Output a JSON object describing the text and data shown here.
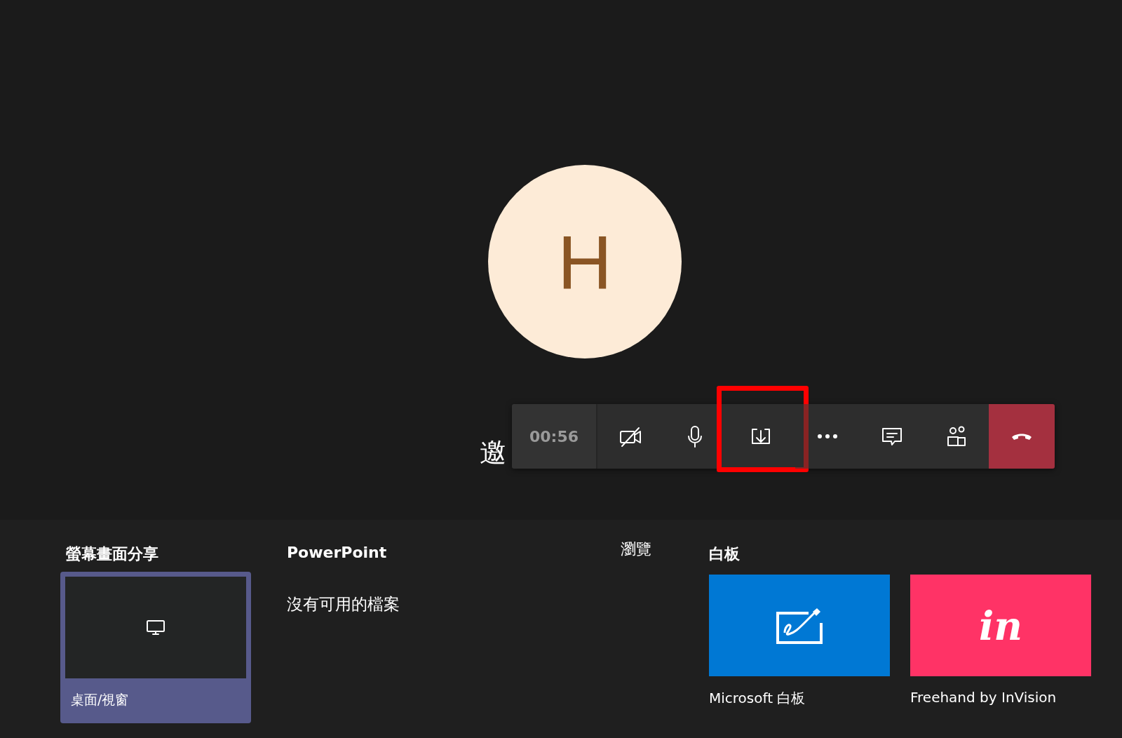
{
  "avatar": {
    "initial": "H"
  },
  "invite_text": "邀",
  "toolbar": {
    "timer": "00:56",
    "buttons": [
      {
        "kind": "camera",
        "on": false,
        "highlighted": false
      },
      {
        "kind": "mic",
        "on": true,
        "highlighted": false
      },
      {
        "kind": "share",
        "highlighted": true
      },
      {
        "kind": "more",
        "highlighted": false
      },
      {
        "kind": "chat",
        "highlighted": false
      },
      {
        "kind": "people",
        "highlighted": false
      },
      {
        "kind": "hangup",
        "highlighted": false
      }
    ]
  },
  "share_tray": {
    "screen_share": {
      "title": "螢幕畫面分享",
      "items": [
        {
          "label": "桌面/視窗",
          "selected": true
        }
      ]
    },
    "powerpoint": {
      "title": "PowerPoint",
      "browse": "瀏覽",
      "empty": "沒有可用的檔案"
    },
    "whiteboard": {
      "title": "白板",
      "apps": [
        {
          "kind": "microsoft",
          "label": "Microsoft 白板",
          "color": "#0078d4"
        },
        {
          "kind": "invision",
          "label": "Freehand by InVision",
          "color": "#ff3366",
          "logo": "in"
        }
      ]
    }
  }
}
